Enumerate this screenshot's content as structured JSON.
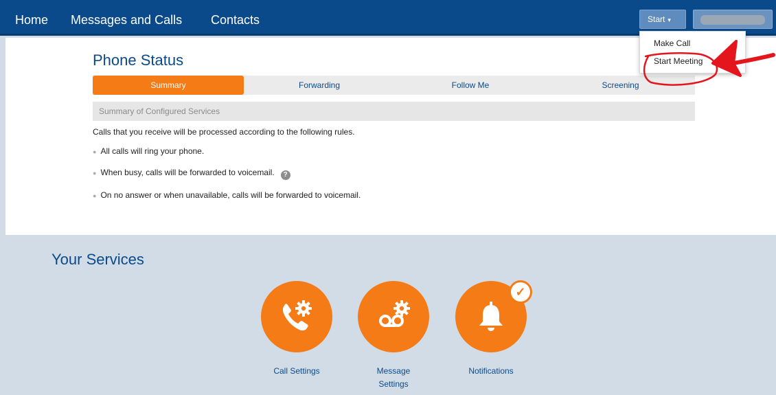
{
  "nav": {
    "items": [
      "Home",
      "Messages and Calls",
      "Contacts"
    ],
    "start_label": "Start",
    "start_caret": "▾"
  },
  "dropdown": {
    "items": [
      "Make Call",
      "Start Meeting"
    ]
  },
  "page": {
    "title": "Phone Status",
    "tabs": [
      "Summary",
      "Forwarding",
      "Follow Me",
      "Screening"
    ],
    "active_tab": "Summary",
    "section_title": "Summary of Configured Services",
    "intro": "Calls that you receive will be processed according to the following rules.",
    "rules": [
      "All calls will ring your phone.",
      "When busy, calls will be forwarded to voicemail.",
      "On no answer or when unavailable, calls will be forwarded to voicemail."
    ],
    "help_glyph": "?"
  },
  "services": {
    "title": "Your Services",
    "items": [
      {
        "label": "Call Settings",
        "icon": "phone-gear-icon"
      },
      {
        "label": "Message Settings",
        "icon": "voicemail-gear-icon"
      },
      {
        "label": "Notifications",
        "icon": "bell-icon"
      }
    ],
    "check_glyph": "✓"
  },
  "colors": {
    "nav_bg": "#0b4a8a",
    "accent_orange": "#f47b15",
    "services_bg": "#d1dce6",
    "annotation_red": "#e5151c"
  }
}
